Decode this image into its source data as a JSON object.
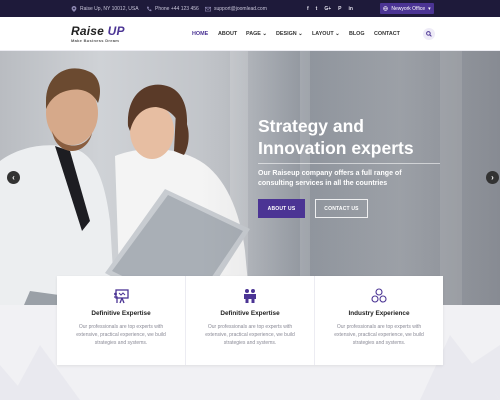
{
  "topbar": {
    "address": "Raise Up, NY 10012, USA",
    "phone": "Phone +44 123 456",
    "email": "support@joomlead.com",
    "socials": [
      "f",
      "t",
      "G+",
      "P",
      "in"
    ],
    "office_label": "Newyork Office"
  },
  "nav": {
    "logo_name": "Raise",
    "logo_up": "UP",
    "logo_tagline": "Make Business Dream",
    "items": [
      {
        "label": "HOME",
        "active": true
      },
      {
        "label": "ABOUT",
        "dropdown": false
      },
      {
        "label": "PAGE",
        "dropdown": true
      },
      {
        "label": "DESIGN",
        "dropdown": true
      },
      {
        "label": "LAYOUT",
        "dropdown": true
      },
      {
        "label": "BLOG",
        "dropdown": false
      },
      {
        "label": "CONTACT",
        "dropdown": false
      }
    ]
  },
  "hero": {
    "headline_line1": "Strategy and",
    "headline_line2": "Innovation experts",
    "description": "Our Raiseup company offers a full range of consulting services in all the countries",
    "btn_about": "ABOUT US",
    "btn_contact": "CONTACT US"
  },
  "features": [
    {
      "icon": "presentation-icon",
      "title": "Definitive Expertise",
      "text": "Our professionals are top experts with extensive, practical experience, we build strategies and systems."
    },
    {
      "icon": "team-icon",
      "title": "Definitive Expertise",
      "text": "Our professionals are top experts with extensive, practical experience, we build strategies and systems."
    },
    {
      "icon": "network-icon",
      "title": "Industry Experience",
      "text": "Our professionals are top experts with extensive, practical experience, we build strategies and systems."
    }
  ],
  "colors": {
    "accent": "#4b3494",
    "topbar": "#1e1a3a"
  }
}
